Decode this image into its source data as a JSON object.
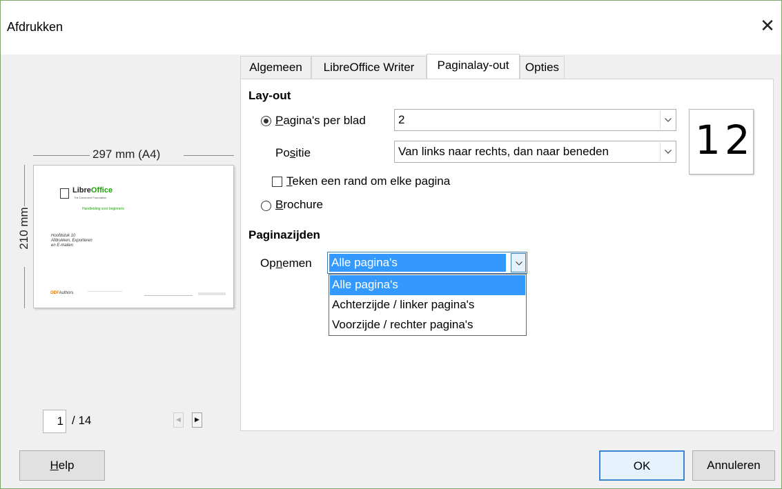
{
  "window": {
    "title": "Afdrukken"
  },
  "preview": {
    "width_label": "297 mm (A4)",
    "height_label": "210 mm",
    "thumb": {
      "logo_libre": "Libre",
      "logo_office": "Office",
      "logo_sub": "The Document Foundation",
      "green_line": "Handleiding voor beginners",
      "chapter_lines": [
        "Hoofdstuk 10",
        "Afdrukken, Exporteren",
        "en E-mailen"
      ],
      "footer_odf": "ODF",
      "footer_authors": "Authors"
    },
    "page_current": "1",
    "page_total": "/ 14"
  },
  "tabs": [
    {
      "label": "Algemeen"
    },
    {
      "label": "LibreOffice Writer"
    },
    {
      "label": "Paginalay-out"
    },
    {
      "label": "Opties"
    }
  ],
  "layout": {
    "heading": "Lay-out",
    "pages_per_sheet_label_u": "P",
    "pages_per_sheet_label_rest": "agina's per blad",
    "pages_per_sheet_value": "2",
    "position_label_pre": "Po",
    "position_label_u": "s",
    "position_label_post": "itie",
    "position_value": "Van links naar rechts, dan naar beneden",
    "draw_border_label_u": "T",
    "draw_border_label_rest": "eken een rand om elke pagina",
    "brochure_label_u": "B",
    "brochure_label_rest": "rochure",
    "preview_number": "12"
  },
  "page_sides": {
    "heading": "Paginazijden",
    "include_label_pre": "Op",
    "include_label_u": "n",
    "include_label_post": "emen",
    "include_value": "Alle pagina's",
    "options": [
      "Alle pagina's",
      "Achterzijde / linker pagina's",
      "Voorzijde / rechter pagina's"
    ]
  },
  "buttons": {
    "help_u": "H",
    "help_rest": "elp",
    "ok": "OK",
    "cancel": "Annuleren"
  }
}
